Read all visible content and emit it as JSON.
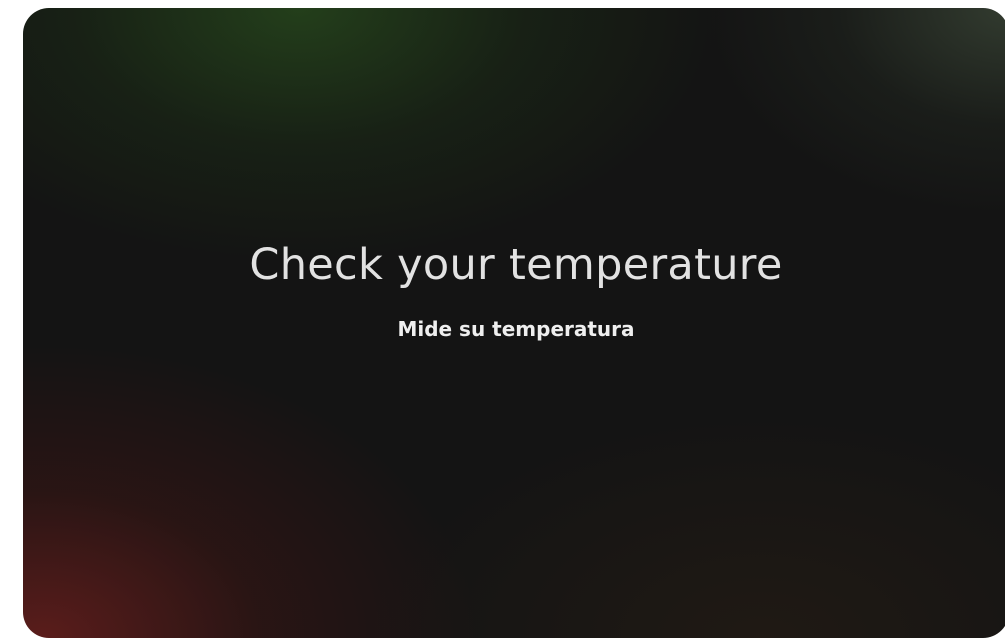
{
  "screen": {
    "title": "Check your temperature",
    "subtitle": "Mide su temperatura"
  },
  "colors": {
    "background": "#141414",
    "title": "#e2e2e2",
    "subtitle": "#efefef",
    "glow_green": "#26461c",
    "glow_red": "#78201e",
    "glow_gray_green": "#3c4838"
  }
}
